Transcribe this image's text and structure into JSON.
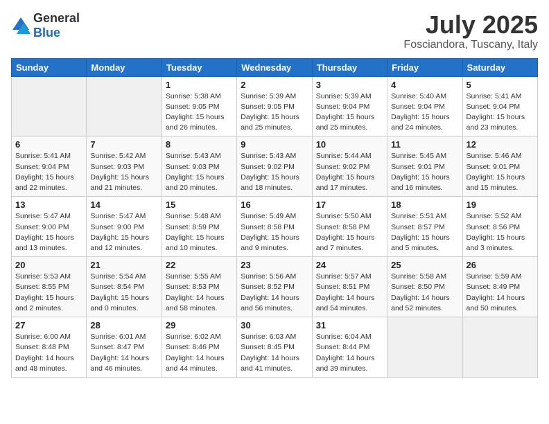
{
  "header": {
    "logo_general": "General",
    "logo_blue": "Blue",
    "month": "July 2025",
    "location": "Fosciandora, Tuscany, Italy"
  },
  "weekdays": [
    "Sunday",
    "Monday",
    "Tuesday",
    "Wednesday",
    "Thursday",
    "Friday",
    "Saturday"
  ],
  "weeks": [
    [
      {
        "day": "",
        "sunrise": "",
        "sunset": "",
        "daylight": ""
      },
      {
        "day": "",
        "sunrise": "",
        "sunset": "",
        "daylight": ""
      },
      {
        "day": "1",
        "sunrise": "Sunrise: 5:38 AM",
        "sunset": "Sunset: 9:05 PM",
        "daylight": "Daylight: 15 hours and 26 minutes."
      },
      {
        "day": "2",
        "sunrise": "Sunrise: 5:39 AM",
        "sunset": "Sunset: 9:05 PM",
        "daylight": "Daylight: 15 hours and 25 minutes."
      },
      {
        "day": "3",
        "sunrise": "Sunrise: 5:39 AM",
        "sunset": "Sunset: 9:04 PM",
        "daylight": "Daylight: 15 hours and 25 minutes."
      },
      {
        "day": "4",
        "sunrise": "Sunrise: 5:40 AM",
        "sunset": "Sunset: 9:04 PM",
        "daylight": "Daylight: 15 hours and 24 minutes."
      },
      {
        "day": "5",
        "sunrise": "Sunrise: 5:41 AM",
        "sunset": "Sunset: 9:04 PM",
        "daylight": "Daylight: 15 hours and 23 minutes."
      }
    ],
    [
      {
        "day": "6",
        "sunrise": "Sunrise: 5:41 AM",
        "sunset": "Sunset: 9:04 PM",
        "daylight": "Daylight: 15 hours and 22 minutes."
      },
      {
        "day": "7",
        "sunrise": "Sunrise: 5:42 AM",
        "sunset": "Sunset: 9:03 PM",
        "daylight": "Daylight: 15 hours and 21 minutes."
      },
      {
        "day": "8",
        "sunrise": "Sunrise: 5:43 AM",
        "sunset": "Sunset: 9:03 PM",
        "daylight": "Daylight: 15 hours and 20 minutes."
      },
      {
        "day": "9",
        "sunrise": "Sunrise: 5:43 AM",
        "sunset": "Sunset: 9:02 PM",
        "daylight": "Daylight: 15 hours and 18 minutes."
      },
      {
        "day": "10",
        "sunrise": "Sunrise: 5:44 AM",
        "sunset": "Sunset: 9:02 PM",
        "daylight": "Daylight: 15 hours and 17 minutes."
      },
      {
        "day": "11",
        "sunrise": "Sunrise: 5:45 AM",
        "sunset": "Sunset: 9:01 PM",
        "daylight": "Daylight: 15 hours and 16 minutes."
      },
      {
        "day": "12",
        "sunrise": "Sunrise: 5:46 AM",
        "sunset": "Sunset: 9:01 PM",
        "daylight": "Daylight: 15 hours and 15 minutes."
      }
    ],
    [
      {
        "day": "13",
        "sunrise": "Sunrise: 5:47 AM",
        "sunset": "Sunset: 9:00 PM",
        "daylight": "Daylight: 15 hours and 13 minutes."
      },
      {
        "day": "14",
        "sunrise": "Sunrise: 5:47 AM",
        "sunset": "Sunset: 9:00 PM",
        "daylight": "Daylight: 15 hours and 12 minutes."
      },
      {
        "day": "15",
        "sunrise": "Sunrise: 5:48 AM",
        "sunset": "Sunset: 8:59 PM",
        "daylight": "Daylight: 15 hours and 10 minutes."
      },
      {
        "day": "16",
        "sunrise": "Sunrise: 5:49 AM",
        "sunset": "Sunset: 8:58 PM",
        "daylight": "Daylight: 15 hours and 9 minutes."
      },
      {
        "day": "17",
        "sunrise": "Sunrise: 5:50 AM",
        "sunset": "Sunset: 8:58 PM",
        "daylight": "Daylight: 15 hours and 7 minutes."
      },
      {
        "day": "18",
        "sunrise": "Sunrise: 5:51 AM",
        "sunset": "Sunset: 8:57 PM",
        "daylight": "Daylight: 15 hours and 5 minutes."
      },
      {
        "day": "19",
        "sunrise": "Sunrise: 5:52 AM",
        "sunset": "Sunset: 8:56 PM",
        "daylight": "Daylight: 15 hours and 3 minutes."
      }
    ],
    [
      {
        "day": "20",
        "sunrise": "Sunrise: 5:53 AM",
        "sunset": "Sunset: 8:55 PM",
        "daylight": "Daylight: 15 hours and 2 minutes."
      },
      {
        "day": "21",
        "sunrise": "Sunrise: 5:54 AM",
        "sunset": "Sunset: 8:54 PM",
        "daylight": "Daylight: 15 hours and 0 minutes."
      },
      {
        "day": "22",
        "sunrise": "Sunrise: 5:55 AM",
        "sunset": "Sunset: 8:53 PM",
        "daylight": "Daylight: 14 hours and 58 minutes."
      },
      {
        "day": "23",
        "sunrise": "Sunrise: 5:56 AM",
        "sunset": "Sunset: 8:52 PM",
        "daylight": "Daylight: 14 hours and 56 minutes."
      },
      {
        "day": "24",
        "sunrise": "Sunrise: 5:57 AM",
        "sunset": "Sunset: 8:51 PM",
        "daylight": "Daylight: 14 hours and 54 minutes."
      },
      {
        "day": "25",
        "sunrise": "Sunrise: 5:58 AM",
        "sunset": "Sunset: 8:50 PM",
        "daylight": "Daylight: 14 hours and 52 minutes."
      },
      {
        "day": "26",
        "sunrise": "Sunrise: 5:59 AM",
        "sunset": "Sunset: 8:49 PM",
        "daylight": "Daylight: 14 hours and 50 minutes."
      }
    ],
    [
      {
        "day": "27",
        "sunrise": "Sunrise: 6:00 AM",
        "sunset": "Sunset: 8:48 PM",
        "daylight": "Daylight: 14 hours and 48 minutes."
      },
      {
        "day": "28",
        "sunrise": "Sunrise: 6:01 AM",
        "sunset": "Sunset: 8:47 PM",
        "daylight": "Daylight: 14 hours and 46 minutes."
      },
      {
        "day": "29",
        "sunrise": "Sunrise: 6:02 AM",
        "sunset": "Sunset: 8:46 PM",
        "daylight": "Daylight: 14 hours and 44 minutes."
      },
      {
        "day": "30",
        "sunrise": "Sunrise: 6:03 AM",
        "sunset": "Sunset: 8:45 PM",
        "daylight": "Daylight: 14 hours and 41 minutes."
      },
      {
        "day": "31",
        "sunrise": "Sunrise: 6:04 AM",
        "sunset": "Sunset: 8:44 PM",
        "daylight": "Daylight: 14 hours and 39 minutes."
      },
      {
        "day": "",
        "sunrise": "",
        "sunset": "",
        "daylight": ""
      },
      {
        "day": "",
        "sunrise": "",
        "sunset": "",
        "daylight": ""
      }
    ]
  ]
}
